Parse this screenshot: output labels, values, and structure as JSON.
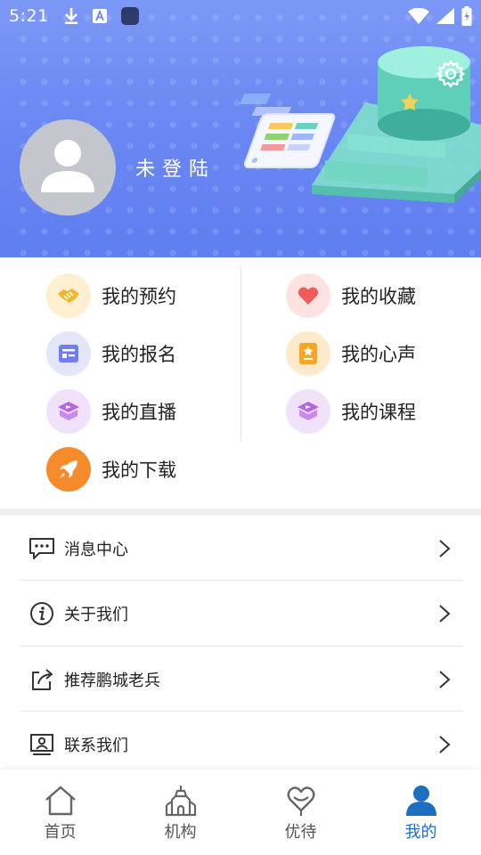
{
  "status_bar": {
    "time": "5:21"
  },
  "header": {
    "login_text": "未登陆",
    "gradient_top": "#7c98f6",
    "gradient_bottom": "#5f7ef0"
  },
  "grid_items": [
    {
      "label": "我的预约",
      "icon": "handshake-icon",
      "bg": "#fdefcf"
    },
    {
      "label": "我的收藏",
      "icon": "heart-icon",
      "bg": "#fde2e2"
    },
    {
      "label": "我的报名",
      "icon": "form-icon",
      "bg": "#e3e6fb"
    },
    {
      "label": "我的心声",
      "icon": "note-star-icon",
      "bg": "#fdeacb"
    },
    {
      "label": "我的直播",
      "icon": "play-box-icon",
      "bg": "#f1e2fb"
    },
    {
      "label": "我的课程",
      "icon": "play-box-icon",
      "bg": "#f1e2fb"
    },
    {
      "label": "我的下载",
      "icon": "rocket-icon",
      "bg": "#f78b2c"
    }
  ],
  "list_items": [
    {
      "label": "消息中心",
      "icon": "message-icon"
    },
    {
      "label": "关于我们",
      "icon": "info-icon"
    },
    {
      "label": "推荐鹏城老兵",
      "icon": "share-icon"
    },
    {
      "label": "联系我们",
      "icon": "contact-icon"
    }
  ],
  "bottom_nav": [
    {
      "label": "首页",
      "icon": "home-icon",
      "active": false
    },
    {
      "label": "机构",
      "icon": "building-icon",
      "active": false
    },
    {
      "label": "优待",
      "icon": "heart-hands-icon",
      "active": false
    },
    {
      "label": "我的",
      "icon": "person-icon",
      "active": true
    }
  ],
  "colors": {
    "accent": "#1c6ec0",
    "divider": "#e6e6e6"
  }
}
